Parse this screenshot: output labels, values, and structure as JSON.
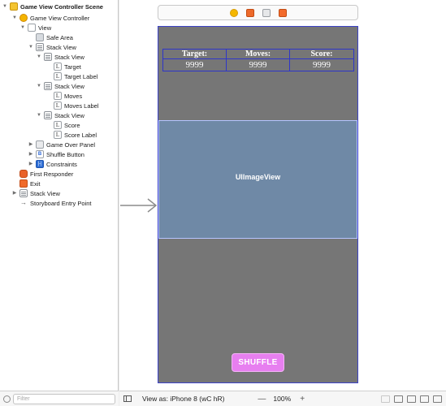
{
  "outline": {
    "items": [
      {
        "label": "Game View Controller Scene",
        "icon": "scene-icon"
      },
      {
        "label": "Game View Controller",
        "icon": "view-controller-icon"
      },
      {
        "label": "View",
        "icon": "view-icon"
      },
      {
        "label": "Safe Area",
        "icon": "safe-area-icon"
      },
      {
        "label": "Stack View",
        "icon": "stack-view-icon"
      },
      {
        "label": "Stack View",
        "icon": "stack-view-icon"
      },
      {
        "label": "Target",
        "icon": "label-icon"
      },
      {
        "label": "Target Label",
        "icon": "label-icon"
      },
      {
        "label": "Stack View",
        "icon": "stack-view-icon"
      },
      {
        "label": "Moves",
        "icon": "label-icon"
      },
      {
        "label": "Moves Label",
        "icon": "label-icon"
      },
      {
        "label": "Stack View",
        "icon": "stack-view-icon"
      },
      {
        "label": "Score",
        "icon": "label-icon"
      },
      {
        "label": "Score Label",
        "icon": "label-icon"
      },
      {
        "label": "Game Over Panel",
        "icon": "panel-icon"
      },
      {
        "label": "Shuffle Button",
        "icon": "button-icon"
      },
      {
        "label": "Constraints",
        "icon": "constraints-icon"
      },
      {
        "label": "First Responder",
        "icon": "first-responder-icon"
      },
      {
        "label": "Exit",
        "icon": "exit-icon"
      },
      {
        "label": "Stack View",
        "icon": "stack-view-icon"
      },
      {
        "label": "Storyboard Entry Point",
        "icon": "entry-arrow-icon"
      }
    ],
    "filter_placeholder": "Filter",
    "label_glyph": "L",
    "button_glyph": "B",
    "constraints_glyph": "|-|"
  },
  "canvas": {
    "headers": [
      "Target:",
      "Moves:",
      "Score:"
    ],
    "values": [
      "9999",
      "9999",
      "9999"
    ],
    "imageview_label": "UIImageView",
    "shuffle_label": "SHUFFLE"
  },
  "bottom_bar": {
    "view_as": "View as: iPhone 8 (wC hR)",
    "zoom": "100%",
    "zoom_out": "—",
    "zoom_in": "+"
  },
  "colors": {
    "phone_background": "#767676",
    "imageview": "#6f89a6",
    "shuffle_button": "#e77ff0",
    "grid_border": "#2e35c9"
  }
}
